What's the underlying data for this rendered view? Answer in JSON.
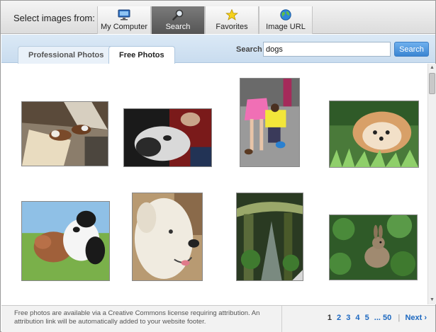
{
  "source_bar": {
    "label": "Select images from:",
    "buttons": [
      {
        "label": "My Computer",
        "icon": "monitor-icon",
        "active": false
      },
      {
        "label": "Search",
        "icon": "magnifier-icon",
        "active": true
      },
      {
        "label": "Favorites",
        "icon": "star-icon",
        "active": false
      },
      {
        "label": "Image URL",
        "icon": "globe-icon",
        "active": false
      }
    ]
  },
  "tabs": [
    {
      "label": "Professional Photos",
      "active": false
    },
    {
      "label": "Free Photos",
      "active": true
    }
  ],
  "search": {
    "label": "Search",
    "value": "dogs",
    "button_label": "Search"
  },
  "results": {
    "thumbnails": [
      {
        "subject": "dogs lying on a sunny floor"
      },
      {
        "subject": "husky being held"
      },
      {
        "subject": "woman in pink skirt with dogs on a street"
      },
      {
        "subject": "fluffy pomeranian in grass"
      },
      {
        "subject": "two dogs playing outdoors"
      },
      {
        "subject": "white dog portrait"
      },
      {
        "subject": "mossy forest creek"
      },
      {
        "subject": "rabbit among plants"
      }
    ]
  },
  "footer": {
    "note": "Free photos are available via a Creative Commons license requiring attribution. An attribution link will be automatically added to your website footer.",
    "pagination": {
      "pages": [
        "1",
        "2",
        "3",
        "4",
        "5"
      ],
      "ellipsis_last": "... 50",
      "current": "1",
      "next_label": "Next ›"
    }
  },
  "colors": {
    "accent_blue": "#3a85d2",
    "link_blue": "#1c68c0",
    "tab_strip": "#c9dcef",
    "active_source": "#555555"
  }
}
